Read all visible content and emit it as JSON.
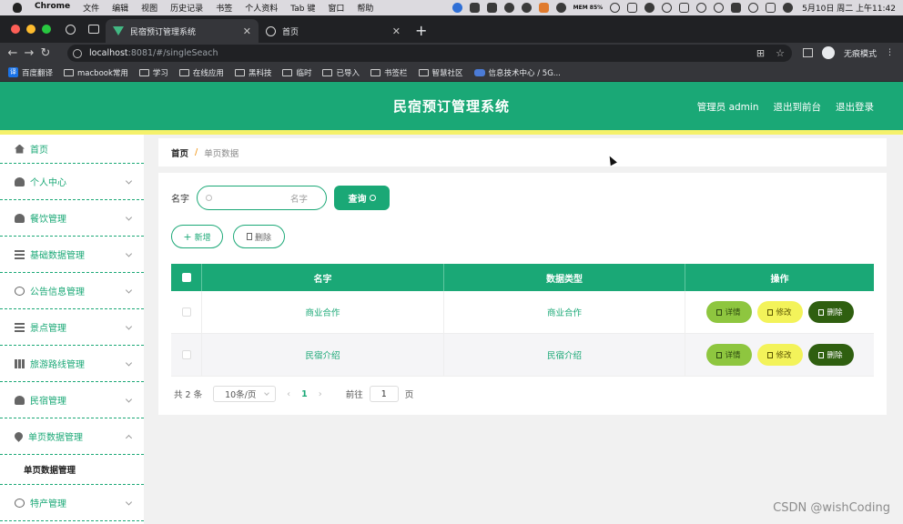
{
  "mac_menu": {
    "items": [
      "Chrome",
      "文件",
      "编辑",
      "视图",
      "历史记录",
      "书签",
      "个人资料",
      "Tab 键",
      "窗口",
      "帮助"
    ],
    "network_label": "MEM 85%",
    "clock": "5月10日 周二 上午11:42"
  },
  "browser": {
    "tabs": [
      {
        "title": "民宿预订管理系统"
      },
      {
        "title": "首页"
      }
    ],
    "url_host": "localhost",
    "url_rest": ":8081/#/singleSeach",
    "profile_label": "无痕模式",
    "bookmarks": [
      "百度翻译",
      "macbook常用",
      "学习",
      "在线应用",
      "黑科技",
      "临时",
      "已导入",
      "书签栏",
      "智慧社区",
      "信息技术中心 / 5G..."
    ]
  },
  "header": {
    "title": "民宿预订管理系统",
    "links": [
      "管理员 admin",
      "退出到前台",
      "退出登录"
    ]
  },
  "sidebar": {
    "items": [
      {
        "label": "首页",
        "icon": "home-icon"
      },
      {
        "label": "个人中心",
        "icon": "user-icon"
      },
      {
        "label": "餐饮管理",
        "icon": "user-icon"
      },
      {
        "label": "基础数据管理",
        "icon": "menu-icon"
      },
      {
        "label": "公告信息管理",
        "icon": "circle-icon"
      },
      {
        "label": "景点管理",
        "icon": "menu-icon"
      },
      {
        "label": "旅游路线管理",
        "icon": "bar-chart-icon"
      },
      {
        "label": "民宿管理",
        "icon": "user-icon"
      },
      {
        "label": "单页数据管理",
        "icon": "location-icon"
      },
      {
        "label": "特产管理",
        "icon": "circle-icon"
      }
    ],
    "sub_item": "单页数据管理"
  },
  "breadcrumb": {
    "home": "首页",
    "separator": "/",
    "current": "单页数据"
  },
  "search": {
    "label": "名字",
    "placeholder": "名字",
    "button": "查询"
  },
  "actions": {
    "add": "新增",
    "delete": "删除"
  },
  "table": {
    "columns": [
      "名字",
      "数据类型",
      "操作"
    ],
    "rows": [
      {
        "name": "商业合作",
        "type": "商业合作"
      },
      {
        "name": "民宿介绍",
        "type": "民宿介绍"
      }
    ],
    "row_actions": {
      "detail": "详情",
      "edit": "修改",
      "delete": "删除"
    }
  },
  "pagination": {
    "total": "共 2 条",
    "page_size": "10条/页",
    "current_page": "1",
    "goto_label": "前往",
    "goto_value": "1",
    "goto_suffix": "页"
  },
  "watermark": "CSDN @wishCoding",
  "colors": {
    "primary": "#1aa876",
    "accent_line": "#f5f16b",
    "detail_btn": "#8ec63f",
    "edit_btn": "#f3f35a",
    "delete_btn": "#2f5f10"
  }
}
